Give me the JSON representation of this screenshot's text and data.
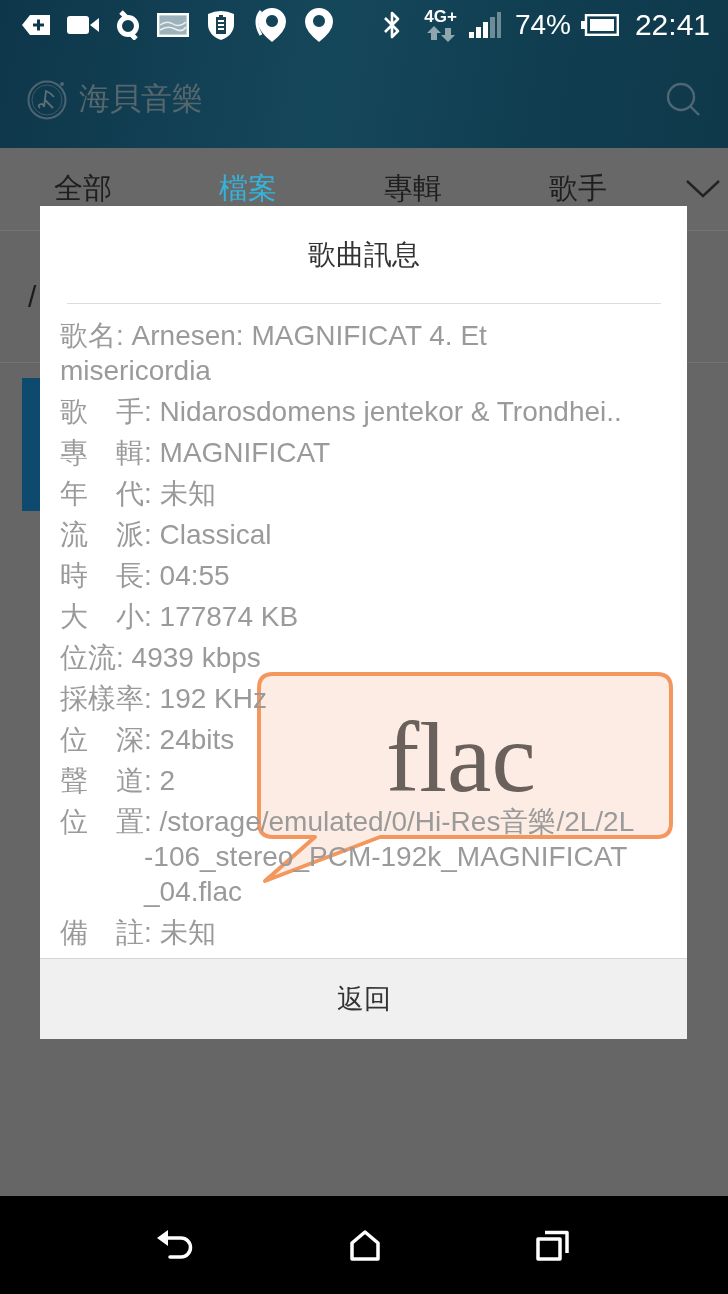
{
  "status_bar": {
    "network": "4G+",
    "battery": "74%",
    "time": "22:41"
  },
  "app_bar": {
    "title": "海貝音樂"
  },
  "tabs": [
    {
      "label": "全部",
      "selected": false
    },
    {
      "label": "檔案",
      "selected": true
    },
    {
      "label": "專輯",
      "selected": false
    },
    {
      "label": "歌手",
      "selected": false
    }
  ],
  "breadcrumb": "/",
  "dialog": {
    "title": "歌曲訊息",
    "rows": [
      {
        "kind": "wrap",
        "text": "歌名: Arnesen: MAGNIFICAT 4. Et misericordia"
      },
      {
        "kind": "line",
        "text": "歌　手: Nidarosdomens jentekor & Trondhei.."
      },
      {
        "kind": "line",
        "text": "專　輯: MAGNIFICAT"
      },
      {
        "kind": "line",
        "text": "年　代: 未知"
      },
      {
        "kind": "line",
        "text": "流　派: Classical"
      },
      {
        "kind": "line",
        "text": "時　長: 04:55"
      },
      {
        "kind": "line",
        "text": "大　小: 177874 KB"
      },
      {
        "kind": "line",
        "text": "位流: 4939 kbps"
      },
      {
        "kind": "line",
        "text": "採樣率: 192 KHz"
      },
      {
        "kind": "line",
        "text": "位　深: 24bits"
      },
      {
        "kind": "line",
        "text": "聲　道: 2"
      },
      {
        "kind": "hanging",
        "label": "位　置",
        "value": ": /storage/emulated/0/Hi-Res音樂/2L/2L-106_stereo_PCM-192k_MAGNIFICAT_04.flac"
      },
      {
        "kind": "line",
        "text": "備　註: 未知"
      }
    ],
    "button": "返回"
  },
  "callout": {
    "text": "flac"
  }
}
